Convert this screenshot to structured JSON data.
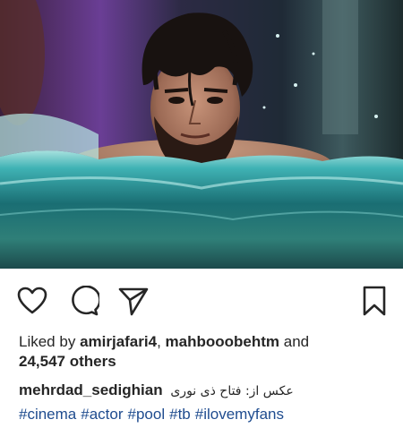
{
  "post": {
    "image_alt": "Man with wet hair in swimming pool",
    "actions": {
      "like_icon": "heart-icon",
      "comment_icon": "comment-bubble-icon",
      "share_icon": "paper-plane-icon",
      "save_icon": "bookmark-icon"
    },
    "likes": {
      "prefix": "Liked by",
      "user_1": "amirjafari4",
      "separator": ",",
      "user_2": "mahbooobehtm",
      "conjunction": "and",
      "count": "24,547",
      "suffix": "others"
    },
    "caption": {
      "author": "mehrdad_sedighian",
      "text": "عکس از: فتاح ذی نوری"
    },
    "hashtags": [
      "#cinema",
      "#actor",
      "#pool",
      "#tb",
      "#ilovemyfans"
    ],
    "colors": {
      "text": "#262626",
      "hashtag": "#1f4c8f",
      "background": "#ffffff"
    }
  }
}
